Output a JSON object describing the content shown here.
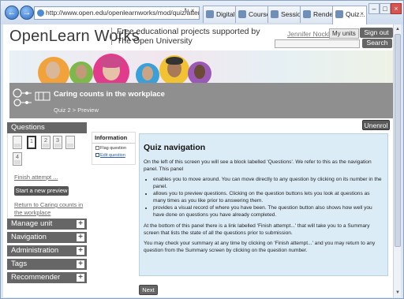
{
  "browser": {
    "address": "http://www.open.edu/openlearnworks/mod/quiz/attempt.php?atter",
    "tabs": [
      {
        "label": "Digital ..."
      },
      {
        "label": "Course: ..."
      },
      {
        "label": "Session ..."
      },
      {
        "label": "Renderi..."
      },
      {
        "label": "Quiz..."
      }
    ]
  },
  "site": {
    "logo": "OpenLearn Works",
    "tagline_line1": "Free educational projects supported by",
    "tagline_line2": "The Open University",
    "user_name": "Jennifer Nockles",
    "my_units": "My units",
    "sign_out": "Sign out",
    "search": "Search"
  },
  "course": {
    "title": "Caring counts in the workplace",
    "breadcrumb": "Quiz 2  >  Preview",
    "unenrol": "Unenrol"
  },
  "questions_block": {
    "title": "Questions",
    "buttons": [
      "1",
      "2",
      "3",
      "4"
    ],
    "finish_attempt": "Finish attempt ...",
    "start_new_preview": "Start a new preview",
    "return_link": "Return to Caring counts in the workplace"
  },
  "side_blocks": [
    {
      "label": "Manage unit"
    },
    {
      "label": "Navigation"
    },
    {
      "label": "Administration"
    },
    {
      "label": "Tags"
    },
    {
      "label": "Recommender"
    }
  ],
  "information": {
    "title": "Information",
    "flag": "Flag question",
    "edit": "Edit question"
  },
  "main": {
    "heading": "Quiz navigation",
    "intro": "On the left of this screen you will see a block labelled 'Questions'. We refer to this as the navigation panel. This panel",
    "bullets": [
      "enables you to move around. You can move directly to any question by clicking on its number in the panel.",
      "allows you to preview questions. Clicking on the question buttons lets you look at questions as many times as you like prior to answering them.",
      "provides a visual record of where you have been. The question button also shows how well you have done on questions you have already completed."
    ],
    "para2": "At the bottom of this panel there is a link labelled 'Finish attempt...' that will take you to a Summary screen that lists the state of all the questions prior to submission.",
    "para3": "You may check your summary at any time by clicking on 'Finish attempt...' and you may return to any question from the Summary screen by clicking on the question number.",
    "next": "Next"
  }
}
